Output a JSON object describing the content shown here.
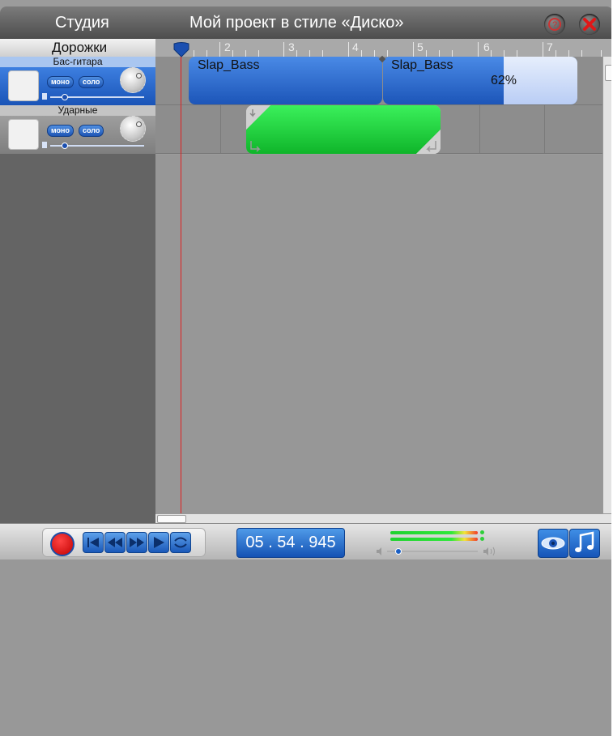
{
  "title_bar": {
    "studio_label": "Студия",
    "project_title": "Мой проект в стиле «Диско»",
    "help_icon": "help-icon",
    "close_icon": "close-icon"
  },
  "tracks_panel": {
    "header": "Дорожки",
    "tracks": [
      {
        "name": "Бас-гитара",
        "mono_label": "моно",
        "solo_label": "соло",
        "selected": true
      },
      {
        "name": "Ударные",
        "mono_label": "моно",
        "solo_label": "соло",
        "selected": false
      }
    ]
  },
  "ruler": {
    "marks": [
      "2",
      "3",
      "4",
      "5",
      "6",
      "7"
    ]
  },
  "clips": {
    "bass": [
      {
        "label": "Slap_Bass"
      },
      {
        "label": "Slap_Bass",
        "progress_text": "62%",
        "progress": 0.62
      }
    ],
    "drums": {
      "color": "#1fc83a"
    }
  },
  "transport": {
    "time": "05 . 54 . 945",
    "buttons": [
      "record",
      "to-start",
      "rewind",
      "fast-forward",
      "play",
      "loop"
    ]
  },
  "colors": {
    "accent_blue": "#1c55b8",
    "record_red": "#d00000",
    "playhead": "#e02020",
    "drum_clip": "#1fc83a"
  }
}
